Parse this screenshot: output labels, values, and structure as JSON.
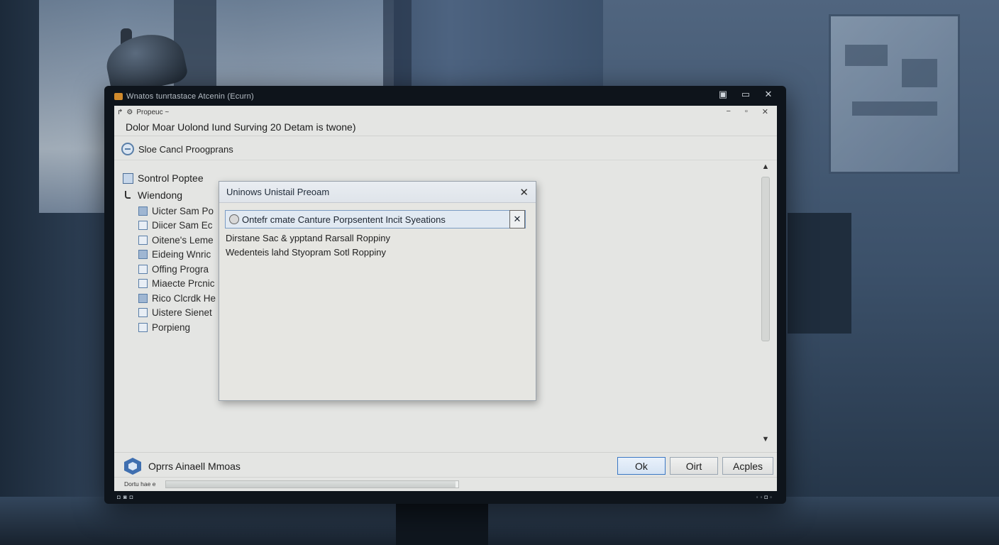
{
  "outer_window": {
    "title": "Wnatos tunrtastace Atcenin (Ecurn)",
    "controls": [
      "▣",
      "▭",
      "✕"
    ]
  },
  "window": {
    "nav_text": "Propeuc ~",
    "controls": [
      "−",
      "▫",
      "✕"
    ],
    "heading": "Dolor Moar Uolond Iund Surving  20 Detam is twone)",
    "toolbar_label": "Sloe Cancl Proogprans"
  },
  "sidebar": {
    "root_label": "Sontrol Poptee",
    "child_label": "Wiendong",
    "items": [
      {
        "label": "Uicter Sam Po",
        "icon": "document-icon"
      },
      {
        "label": "Diicer Sam Ec",
        "icon": "pen-icon"
      },
      {
        "label": "Oitene's Leme",
        "icon": "folder-icon"
      },
      {
        "label": "Eideing Wnric",
        "icon": "list-icon"
      },
      {
        "label": "Offing Progra",
        "icon": "window-icon"
      },
      {
        "label": "Miaecte Prcnic",
        "icon": "page-icon"
      },
      {
        "label": "Rico Clcrdk He",
        "icon": "mail-icon"
      },
      {
        "label": "Uistere Sienet",
        "icon": "box-icon"
      },
      {
        "label": "Porpieng",
        "icon": "card-icon"
      }
    ]
  },
  "dialog": {
    "title": "Uninows Unistail Preoam",
    "field_value": "Ontefr cmate Canture Porpsentent Incit Syeations",
    "line1": "Dirstane Sac & ypptand Rarsall Roppiny",
    "line2": "Wedenteis lahd Styopram Sotl Roppiny"
  },
  "footer": {
    "label": "Oprrs Ainaell Mmoas",
    "ok_label": "Ok",
    "cancel_label": "Oirt",
    "apply_label": "Acples",
    "status_text": "Dortu hae e",
    "progress_fraction": 0.99
  },
  "colors": {
    "accent": "#3b78c4",
    "window_bg": "#e4e5e3",
    "dialog_bg": "#e6e6e2"
  }
}
